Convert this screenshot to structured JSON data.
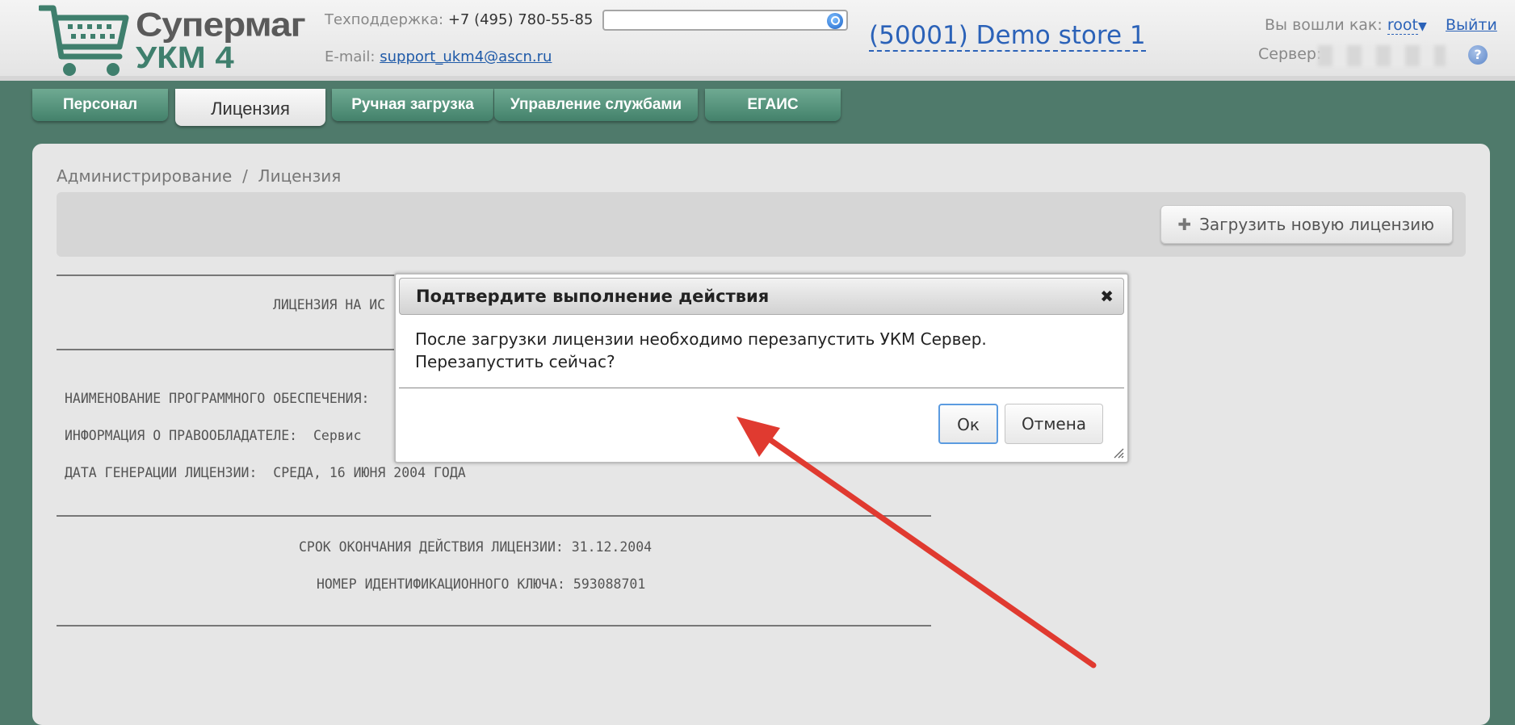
{
  "header": {
    "logo_line1": "Супермаг",
    "logo_line2": "УКМ 4",
    "support_label": "Техподдержка:",
    "support_phone": "+7 (495) 780-55-85",
    "email_label": "E-mail:",
    "email": "support_ukm4@ascn.ru",
    "search_value": "",
    "store": "(50001) Demo store 1",
    "login_label": "Вы вошли как:",
    "user": "root",
    "logout": "Выйти",
    "server_label": "Сервер:",
    "help": "?"
  },
  "tabs": [
    {
      "label": "Персонал"
    },
    {
      "label": "Лицензия"
    },
    {
      "label": "Ручная загрузка"
    },
    {
      "label": "Управление службами"
    },
    {
      "label": "ЕГАИС"
    }
  ],
  "main": {
    "breadcrumb": "Администрирование  /  Лицензия",
    "upload_button": "Загрузить новую лицензию",
    "license": {
      "title_fragment": "ЛИЦЕНЗИЯ НА ИС",
      "software_fragment": "НАИМЕНОВАНИЕ ПРОГРАММНОГО ОБЕСПЕЧЕНИЯ:",
      "owner_fragment": "ИНФОРМАЦИЯ О ПРАВООБЛАДАТЕЛЕ:  Сервис",
      "generation_date": "ДАТА ГЕНЕРАЦИИ ЛИЦЕНЗИИ:  СРЕДА, 16 ИЮНЯ 2004 ГОДА",
      "expiry": "СРОК ОКОНЧАНИЯ ДЕЙСТВИЯ ЛИЦЕНЗИИ: 31.12.2004",
      "key_number": "НОМЕР ИДЕНТИФИКАЦИОННОГО КЛЮЧА: 593088701"
    }
  },
  "dialog": {
    "title": "Подтвердите выполнение действия",
    "close": "✖",
    "message_line1": "После загрузки лицензии необходимо перезапустить УКМ Сервер.",
    "message_line2": "Перезапустить сейчас?",
    "ok": "Ок",
    "cancel": "Отмена"
  },
  "colors": {
    "background": "#4f7a6b",
    "tab": "#5a9a80",
    "link": "#2b62b8",
    "arrow": "#e03a30"
  }
}
